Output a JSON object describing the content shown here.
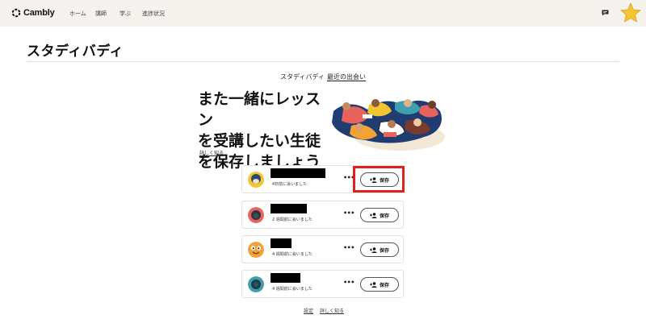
{
  "header": {
    "brand": "Cambly",
    "nav": [
      {
        "label": "ホーム"
      },
      {
        "label": "講師"
      },
      {
        "label": "学ぶ"
      },
      {
        "label": "進捗状況"
      }
    ],
    "icons": {
      "chat": "chat-bubble-icon",
      "star": "star-icon"
    },
    "star_color": "#f5c430"
  },
  "page": {
    "title": "スタディバディ",
    "tabs": [
      {
        "label": "スタディバディ",
        "active": false
      },
      {
        "label": "最近の出会い",
        "active": true
      }
    ]
  },
  "hero": {
    "headline_lines": [
      "また一緒にレッスン",
      "を受講したい生徒",
      "を保存しましょう"
    ],
    "learn_more": "詳しく知る"
  },
  "students": [
    {
      "met": "4日前に会いました",
      "save_label": "保存",
      "avatar_color": "#f3c531",
      "highlighted": true
    },
    {
      "met": "2 週間前に会いました",
      "save_label": "保存",
      "avatar_color": "#e8635c",
      "highlighted": false
    },
    {
      "met": "4 週間前に会いました",
      "save_label": "保存",
      "avatar_color": "#f4a233",
      "highlighted": false
    },
    {
      "met": "4 週間前に会いました",
      "save_label": "保存",
      "avatar_color": "#3f9fae",
      "highlighted": false
    }
  ],
  "footer": {
    "settings": "設定",
    "learn_more": "詳しく知る"
  },
  "colors": {
    "highlight": "#e0201b",
    "topbar": "#f6f3ee"
  }
}
